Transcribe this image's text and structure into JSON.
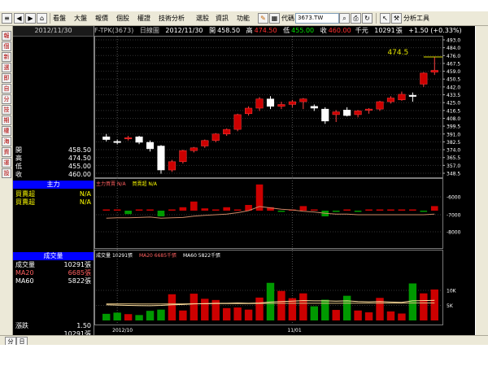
{
  "toolbar": {
    "items": [
      "看盤",
      "大盤",
      "報價",
      "個股",
      "權證",
      "技術分析",
      "選股",
      "資訊",
      "功能"
    ],
    "code_label": "代碼",
    "code_value": "3673.TW",
    "analysis_tool": "分析工具"
  },
  "left_tabs": [
    "報",
    "個",
    "新",
    "選",
    "即",
    "自",
    "分",
    "技",
    "期",
    "權",
    "海",
    "資",
    "運",
    "設"
  ],
  "left_panel": {
    "date": "2012/11/30",
    "ohlc": [
      {
        "label": "開",
        "value": "458.50",
        "color": "#ffffff"
      },
      {
        "label": "高",
        "value": "474.50",
        "color": "#ffffff"
      },
      {
        "label": "低",
        "value": "455.00",
        "color": "#ffffff"
      },
      {
        "label": "收",
        "value": "460.00",
        "color": "#ffffff"
      }
    ],
    "main_force": {
      "title": "主力",
      "rows": [
        {
          "label": "買賣超",
          "value": "N/A",
          "color": "#ffff00"
        },
        {
          "label": "買賣超",
          "value": "N/A",
          "color": "#ffff00"
        }
      ]
    },
    "volume": {
      "title": "成交量",
      "rows": [
        {
          "label": "成交量",
          "value": "10291張",
          "color": "#ffffff"
        },
        {
          "label": "MA20",
          "value": "6685張",
          "color": "#ff6060"
        },
        {
          "label": "MA60",
          "value": "5822張",
          "color": "#ffffff"
        }
      ]
    },
    "bottom": [
      {
        "label": "漲跌",
        "value": "1.50"
      },
      {
        "label": "",
        "value": "10291張"
      }
    ]
  },
  "price_header": {
    "symbol": "F-TPK(3673)",
    "period": "日線圖",
    "date": "2012/11/30",
    "open_label": "開",
    "open": "458.50",
    "high_label": "高",
    "high": "474.50",
    "low_label": "低",
    "low": "455.00",
    "close_label": "收",
    "close": "460.00",
    "close_suffix": "千元",
    "volume": "10291",
    "volume_unit": "張",
    "change": "+1.50 (+0.33%)"
  },
  "indicator_header": {
    "name": "主力買賣",
    "name_value": "N/A",
    "name2": "買賣超",
    "name2_value": "N/A"
  },
  "volume_header": {
    "name": "成交量",
    "value": "10291張",
    "ma20": "MA20 6685千張",
    "ma60": "MA60 5822千張"
  },
  "bottom_tabs": [
    "分",
    "日"
  ],
  "colors": {
    "up": "#cc0000",
    "down": "#ffffff",
    "vol_up": "#cc0000",
    "vol_down": "#009900",
    "ma": "#cc8866",
    "ma60": "#e0e000"
  },
  "chart_data": [
    {
      "type": "candlestick",
      "title": "F-TPK(3673) 日線圖",
      "ylim": [
        348.5,
        493.0
      ],
      "y_ticks": [
        "493.0",
        "484.0",
        "476.0",
        "467.5",
        "459.0",
        "450.5",
        "442.0",
        "433.5",
        "425.0",
        "416.5",
        "408.0",
        "399.5",
        "391.0",
        "382.5",
        "374.0",
        "365.5",
        "357.0",
        "348.5"
      ],
      "annotation": "474.5",
      "ohlc": [
        [
          388,
          391,
          383,
          385
        ],
        [
          383,
          385,
          380,
          382
        ],
        [
          386,
          389,
          384,
          387
        ],
        [
          388,
          389,
          380,
          382
        ],
        [
          382,
          384,
          372,
          375
        ],
        [
          378,
          379,
          348,
          352
        ],
        [
          352,
          363,
          350,
          361
        ],
        [
          361,
          374,
          359,
          373
        ],
        [
          373,
          377,
          371,
          376
        ],
        [
          378,
          385,
          376,
          384
        ],
        [
          384,
          392,
          382,
          391
        ],
        [
          391,
          397,
          389,
          396
        ],
        [
          396,
          413,
          394,
          412
        ],
        [
          413,
          421,
          411,
          419
        ],
        [
          419,
          431,
          416,
          429
        ],
        [
          429,
          432,
          418,
          421
        ],
        [
          421,
          426,
          418,
          423
        ],
        [
          423,
          428,
          420,
          426
        ],
        [
          426,
          430,
          418,
          429
        ],
        [
          421,
          423,
          416,
          419
        ],
        [
          418,
          420,
          402,
          405
        ],
        [
          412,
          417,
          404,
          415
        ],
        [
          417,
          420,
          410,
          411
        ],
        [
          412,
          417,
          409,
          416
        ],
        [
          417,
          419,
          413,
          418
        ],
        [
          418,
          427,
          416,
          426
        ],
        [
          426,
          432,
          424,
          430
        ],
        [
          428,
          437,
          427,
          434
        ],
        [
          433,
          436,
          426,
          432
        ],
        [
          445,
          458,
          442,
          457
        ],
        [
          458,
          474,
          455,
          460
        ]
      ],
      "x_labels": [
        {
          "index": 1,
          "text": "2012/10"
        },
        {
          "index": 17,
          "text": "11/01"
        }
      ]
    },
    {
      "type": "bar",
      "title": "主力買賣",
      "y_ticks": [
        "6000",
        "7000",
        "8000"
      ],
      "values": [
        0.1,
        0,
        -0.3,
        0.1,
        0.1,
        -0.5,
        0.1,
        0.3,
        0.8,
        0.2,
        0.1,
        0.3,
        0.1,
        0.5,
        2.3,
        0.3,
        -0.1,
        0.1,
        0.4,
        0.1,
        -0.5,
        -0.1,
        0.1,
        -0.1,
        0.1,
        0.1,
        0.1,
        0.1,
        0.1,
        -0.1,
        0.4
      ],
      "line": [
        -0.5,
        -0.45,
        -0.45,
        -0.4,
        -0.35,
        -0.5,
        -0.45,
        -0.4,
        -0.2,
        -0.1,
        0,
        0.1,
        0.3,
        0.6,
        1.2,
        1.0,
        0.8,
        0.7,
        0.5,
        0.4,
        0.2,
        0.1,
        0.1,
        0,
        0,
        0,
        0,
        0,
        0,
        0,
        0.1
      ]
    },
    {
      "type": "bar",
      "title": "成交量",
      "y_ticks": [
        "10K",
        "5K"
      ],
      "values": [
        2200,
        2600,
        2100,
        1800,
        3200,
        3600,
        8700,
        3300,
        8900,
        7200,
        6800,
        4100,
        4300,
        3600,
        7600,
        12500,
        9800,
        7400,
        9000,
        4700,
        6900,
        3500,
        8200,
        3300,
        2700,
        7500,
        3000,
        2300,
        12300,
        9000,
        10291
      ],
      "ma20": [
        5200,
        5100,
        5000,
        4950,
        4900,
        5000,
        5200,
        5300,
        5500,
        5600,
        5700,
        5700,
        5800,
        5700,
        5800,
        6100,
        6300,
        6400,
        6600,
        6500,
        6500,
        6400,
        6500,
        6300,
        6200,
        6300,
        6100,
        6000,
        6500,
        6600,
        6685
      ],
      "ma60": [
        5500,
        5500,
        5500,
        5450,
        5450,
        5450,
        5500,
        5500,
        5550,
        5550,
        5600,
        5600,
        5600,
        5600,
        5650,
        5650,
        5700,
        5700,
        5700,
        5700,
        5700,
        5700,
        5750,
        5750,
        5750,
        5750,
        5750,
        5750,
        5800,
        5800,
        5822
      ],
      "x_labels": [
        {
          "index": 1,
          "text": "2012/10"
        },
        {
          "index": 17,
          "text": "11/01"
        }
      ]
    }
  ]
}
